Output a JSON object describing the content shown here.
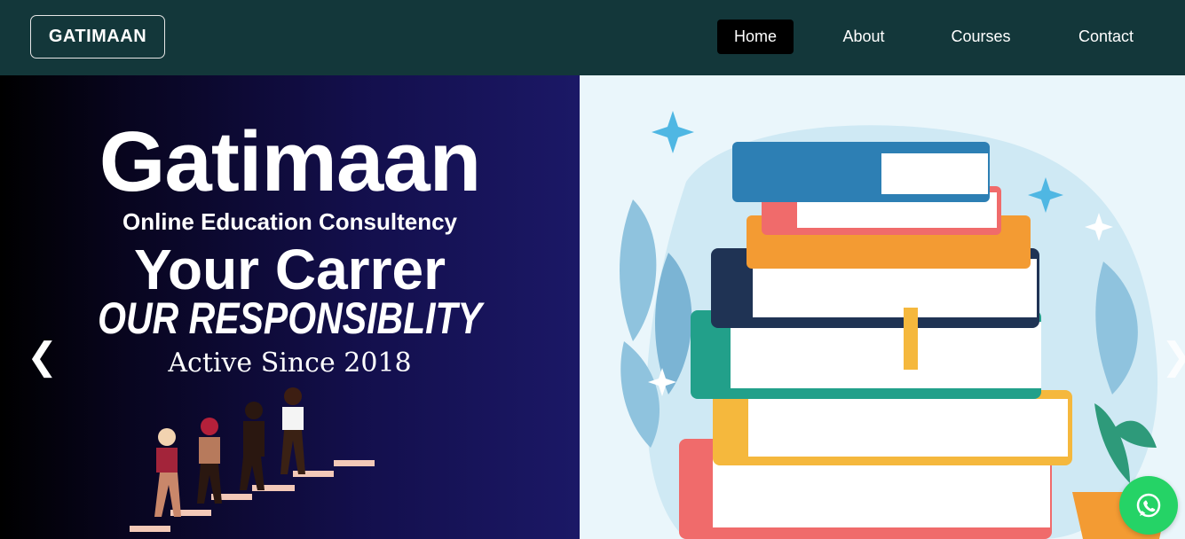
{
  "brand": {
    "label": "GATIMAAN"
  },
  "nav": {
    "items": [
      {
        "label": "Home",
        "active": true
      },
      {
        "label": "About",
        "active": false
      },
      {
        "label": "Courses",
        "active": false
      },
      {
        "label": "Contact",
        "active": false
      }
    ]
  },
  "hero": {
    "title": "Gatimaan",
    "subtitle": "Online Education Consultency",
    "tagline_1": "Your Carrer",
    "tagline_2": "OUR RESPONSIBLITY",
    "since": "Active Since 2018"
  },
  "carousel": {
    "prev_icon": "❮",
    "next_icon": "❯"
  },
  "icons": {
    "whatsapp": "whatsapp-icon"
  },
  "colors": {
    "navbar": "#13373a",
    "active_nav": "#000000",
    "hero_bg": "#130f4c",
    "whatsapp": "#25d366"
  }
}
